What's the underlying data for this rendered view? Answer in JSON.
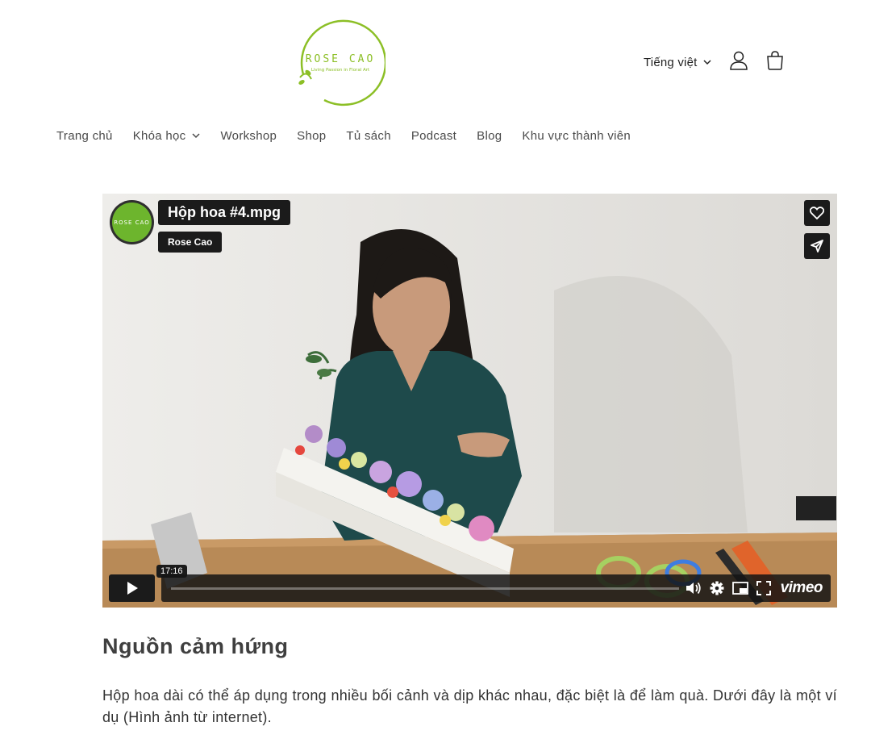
{
  "brand": {
    "name": "ROSE CAO",
    "tagline": "Living Passion in Floral Art",
    "accent_color": "#8cbf26"
  },
  "header": {
    "language_label": "Tiếng việt",
    "icons": [
      "chevron-down-icon",
      "account-icon",
      "cart-icon"
    ]
  },
  "nav": {
    "items": [
      {
        "label": "Trang chủ"
      },
      {
        "label": "Khóa học",
        "has_dropdown": true
      },
      {
        "label": "Workshop"
      },
      {
        "label": "Shop"
      },
      {
        "label": "Tủ sách"
      },
      {
        "label": "Podcast"
      },
      {
        "label": "Blog"
      },
      {
        "label": "Khu vực thành viên"
      }
    ]
  },
  "video": {
    "title": "Hộp hoa #4.mpg",
    "author": "Rose Cao",
    "duration": "17:16",
    "progress_fraction": 0.0,
    "player_brand": "vimeo",
    "avatar_text": "ROSE CAO",
    "side_buttons": [
      "heart-icon",
      "share-icon"
    ],
    "control_icons": [
      "play-icon",
      "volume-icon",
      "settings-icon",
      "pip-icon",
      "fullscreen-icon"
    ]
  },
  "article": {
    "heading": "Nguồn cảm hứng",
    "paragraph": "Hộp hoa dài có thể áp dụng trong nhiều bối cảnh và dịp khác nhau, đặc biệt là để làm quà. Dưới đây là một ví dụ (Hình ảnh từ internet)."
  }
}
